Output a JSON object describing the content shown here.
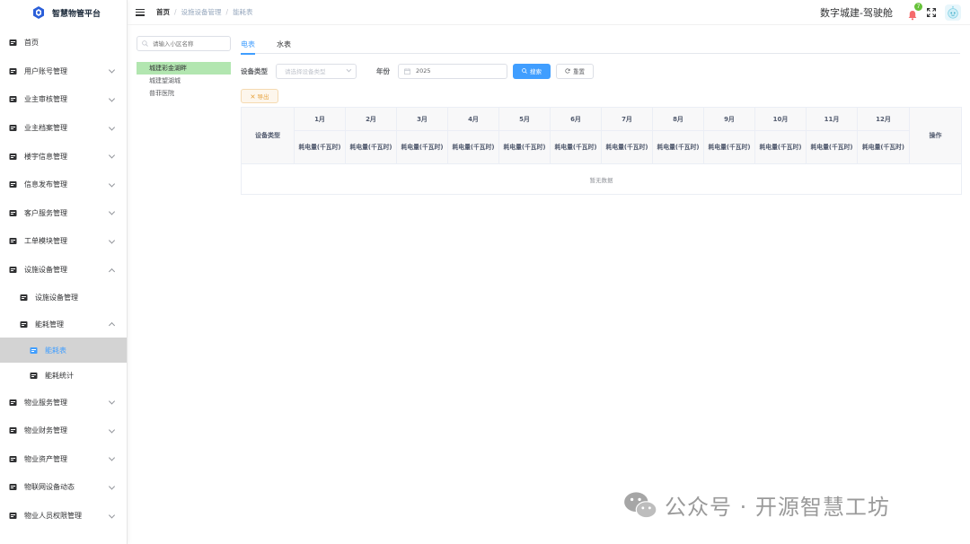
{
  "app": {
    "title": "智慧物管平台"
  },
  "sidebar": {
    "items": [
      {
        "label": "首页",
        "icon": "dashboard-icon",
        "arrow": false
      },
      {
        "label": "用户账号管理",
        "icon": "user-account-icon",
        "arrow": "down"
      },
      {
        "label": "业主审核管理",
        "icon": "owner-audit-icon",
        "arrow": "down"
      },
      {
        "label": "业主档案管理",
        "icon": "owner-archive-icon",
        "arrow": "down"
      },
      {
        "label": "楼宇信息管理",
        "icon": "building-icon",
        "arrow": "down"
      },
      {
        "label": "信息发布管理",
        "icon": "document-icon",
        "arrow": "down"
      },
      {
        "label": "客户服务管理",
        "icon": "folder-icon",
        "arrow": "down"
      },
      {
        "label": "工单模块管理",
        "icon": "workorder-icon",
        "arrow": "down"
      },
      {
        "label": "设施设备管理",
        "icon": "equipment-icon",
        "arrow": "up"
      }
    ],
    "sub_equipment": {
      "label": "设施设备管理",
      "icon": "equipment-sub-icon"
    },
    "sub_energy": {
      "label": "能耗管理",
      "icon": "drop-icon",
      "arrow": "up"
    },
    "sub_energy_table": {
      "label": "能耗表",
      "icon": "meter-table-icon"
    },
    "sub_energy_stats": {
      "label": "能耗统计",
      "icon": "stats-icon"
    },
    "items_after": [
      {
        "label": "物业服务管理",
        "icon": "service-icon",
        "arrow": "down"
      },
      {
        "label": "物业财务管理",
        "icon": "finance-icon",
        "arrow": "down"
      },
      {
        "label": "物业资产管理",
        "icon": "asset-icon",
        "arrow": "down"
      },
      {
        "label": "物联网设备动态",
        "icon": "iot-icon",
        "arrow": "down"
      },
      {
        "label": "物业人员权限管理",
        "icon": "permission-icon",
        "arrow": "down"
      }
    ]
  },
  "header": {
    "breadcrumb": [
      "首页",
      "设施设备管理",
      "能耗表"
    ],
    "breadcrumb_sep": "/",
    "org_name": "数字城建-驾驶舱",
    "notification_count": "7"
  },
  "tree": {
    "search_placeholder": "请输入小区名称",
    "nodes": [
      "城建彩金湖畔",
      "城建望湖城",
      "普菲医院"
    ],
    "selected_index": 0
  },
  "tabs": [
    {
      "label": "电表",
      "active": true
    },
    {
      "label": "水表",
      "active": false
    }
  ],
  "filters": {
    "device_type_label": "设备类型",
    "device_type_placeholder": "请选择设备类型",
    "year_label": "年份",
    "year_value": "2025",
    "search_button": "搜索",
    "reset_button": "重置",
    "export_button": "导出"
  },
  "table": {
    "col_device_type": "设备类型",
    "col_action": "操作",
    "months": [
      "1月",
      "2月",
      "3月",
      "4月",
      "5月",
      "6月",
      "7月",
      "8月",
      "9月",
      "10月",
      "11月",
      "12月"
    ],
    "unit_label": "耗电量(千瓦时)",
    "empty_text": "暂无数据"
  },
  "watermark": {
    "text": "公众号 · 开源智慧工坊"
  },
  "colors": {
    "primary": "#409eff",
    "active_tree": "#b2e6b0",
    "badge": "#67c23a",
    "export": "#e6a23c"
  }
}
